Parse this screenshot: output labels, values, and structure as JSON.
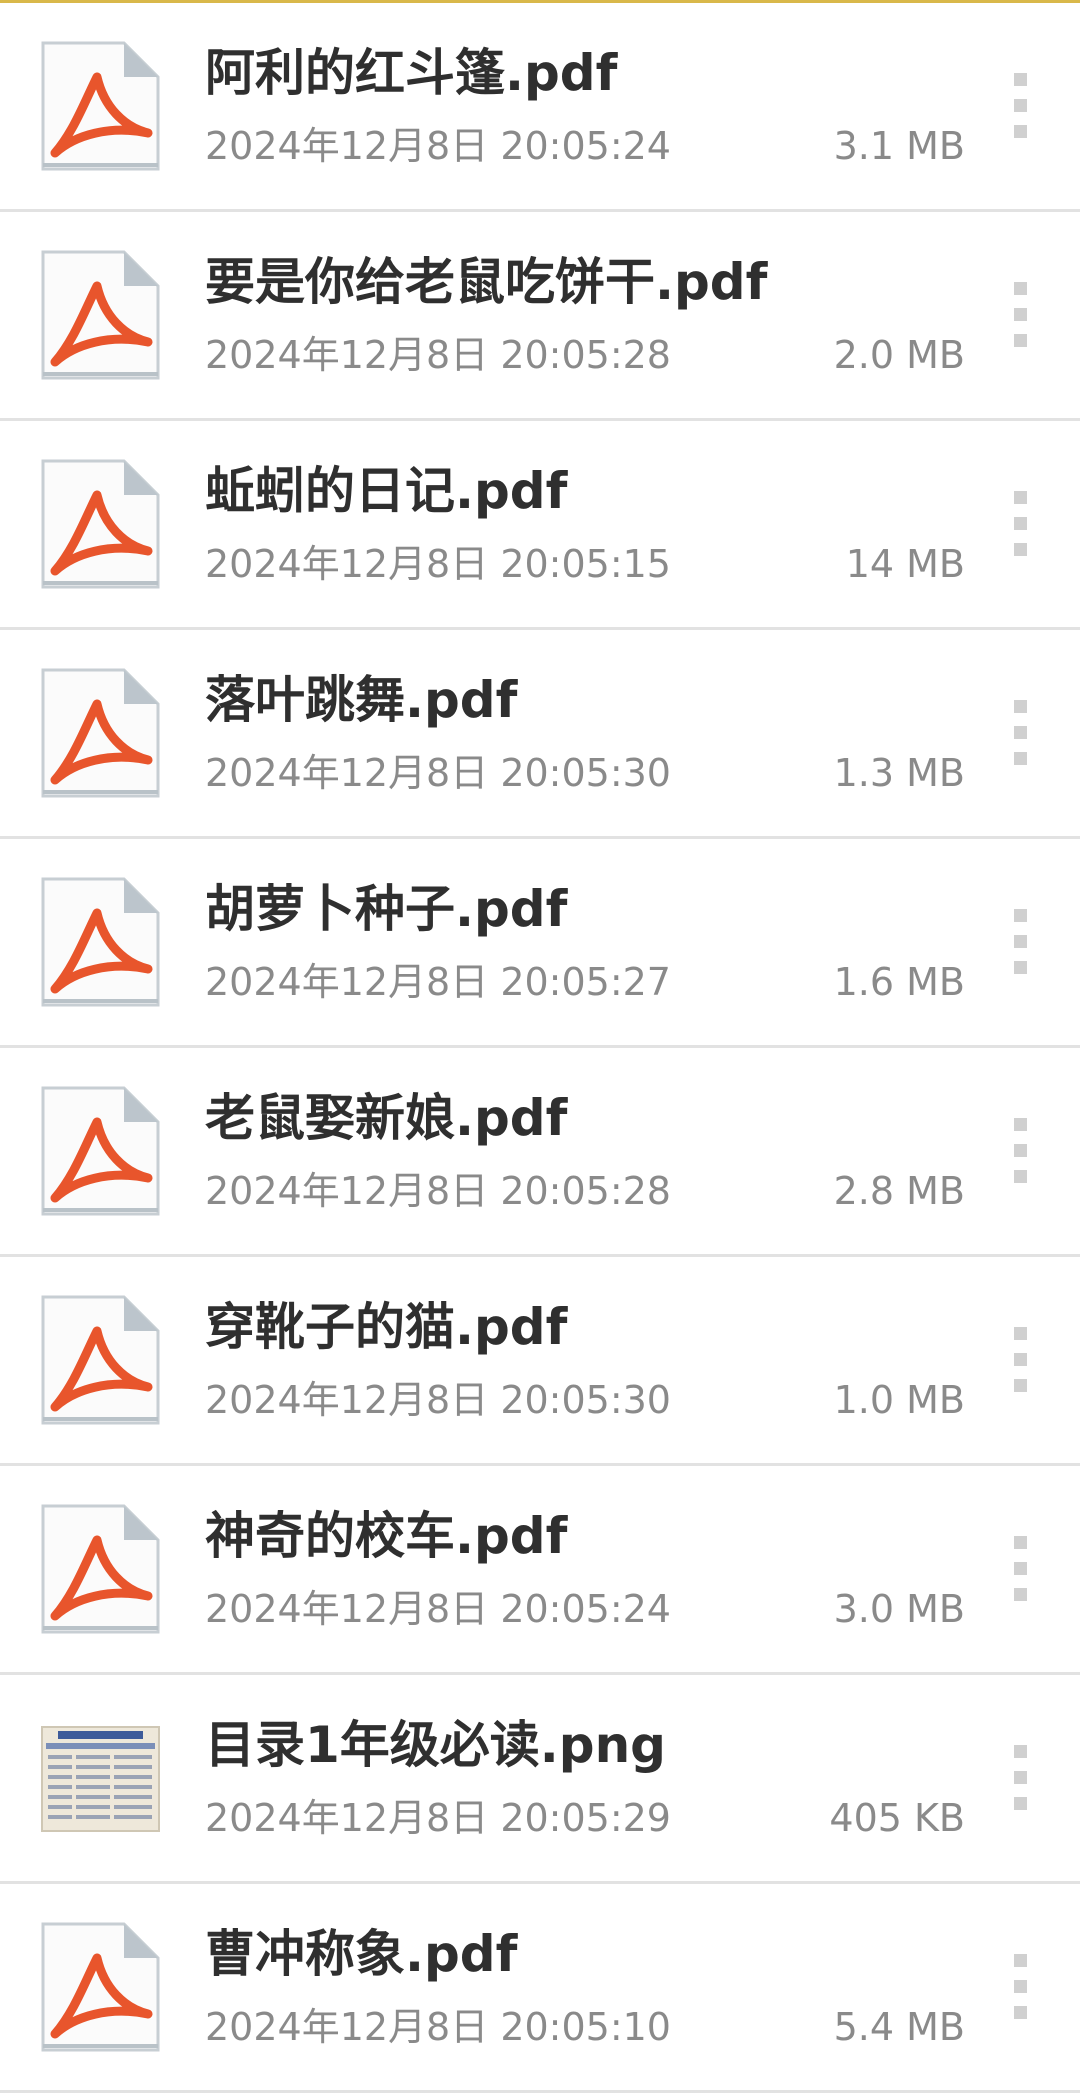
{
  "accent_color": "#d9b84a",
  "pdf_icon_color": "#e8552c",
  "files": [
    {
      "name": "阿利的红斗篷.pdf",
      "date": "2024年12月8日 20:05:24",
      "size": "3.1 MB",
      "icon": "pdf-icon"
    },
    {
      "name": "要是你给老鼠吃饼干.pdf",
      "date": "2024年12月8日 20:05:28",
      "size": "2.0 MB",
      "icon": "pdf-icon"
    },
    {
      "name": "蚯蚓的日记.pdf",
      "date": "2024年12月8日 20:05:15",
      "size": "14 MB",
      "icon": "pdf-icon"
    },
    {
      "name": "落叶跳舞.pdf",
      "date": "2024年12月8日 20:05:30",
      "size": "1.3 MB",
      "icon": "pdf-icon"
    },
    {
      "name": "胡萝卜种子.pdf",
      "date": "2024年12月8日 20:05:27",
      "size": "1.6 MB",
      "icon": "pdf-icon"
    },
    {
      "name": "老鼠娶新娘.pdf",
      "date": "2024年12月8日 20:05:28",
      "size": "2.8 MB",
      "icon": "pdf-icon"
    },
    {
      "name": "穿靴子的猫.pdf",
      "date": "2024年12月8日 20:05:30",
      "size": "1.0 MB",
      "icon": "pdf-icon"
    },
    {
      "name": "神奇的校车.pdf",
      "date": "2024年12月8日 20:05:24",
      "size": "3.0 MB",
      "icon": "pdf-icon"
    },
    {
      "name": "目录1年级必读.png",
      "date": "2024年12月8日 20:05:29",
      "size": "405 KB",
      "icon": "image-thumbnail"
    },
    {
      "name": "曹冲称象.pdf",
      "date": "2024年12月8日 20:05:10",
      "size": "5.4 MB",
      "icon": "pdf-icon"
    }
  ]
}
